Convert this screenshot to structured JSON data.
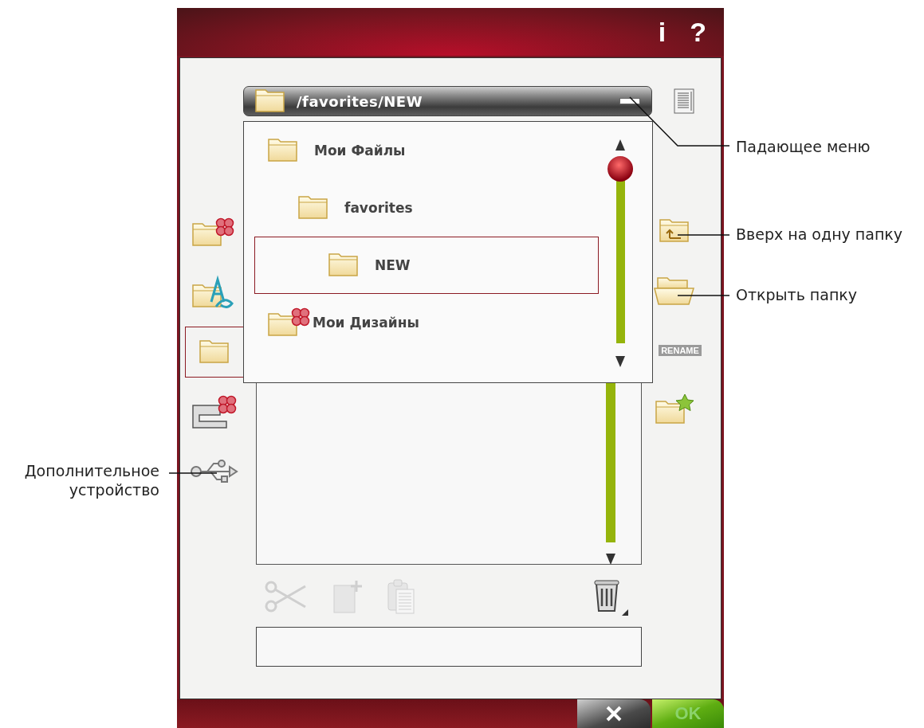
{
  "header": {
    "info": "i",
    "help": "?"
  },
  "path_bar": {
    "path": "/favorites/NEW"
  },
  "dropdown": {
    "items": [
      {
        "label": "Мои Файлы",
        "kind": "folder",
        "selected": false,
        "children": [
          {
            "label": "favorites",
            "kind": "folder",
            "selected": false,
            "children": [
              {
                "label": "NEW",
                "kind": "folder",
                "selected": true
              }
            ]
          }
        ]
      },
      {
        "label": "Мои Дизайны",
        "kind": "designs",
        "selected": false
      }
    ]
  },
  "left_tools": [
    {
      "kind": "designs",
      "selected": false
    },
    {
      "kind": "fonts",
      "selected": false
    },
    {
      "kind": "folder",
      "selected": true
    },
    {
      "kind": "machine",
      "selected": false
    },
    {
      "kind": "usb",
      "selected": false
    }
  ],
  "right_tools": [
    {
      "kind": "up"
    },
    {
      "kind": "open"
    },
    {
      "kind": "rename",
      "label": "RENAME"
    },
    {
      "kind": "favorite"
    }
  ],
  "edit_tools": [
    {
      "kind": "cut",
      "disabled": true
    },
    {
      "kind": "new",
      "disabled": true
    },
    {
      "kind": "paste",
      "disabled": true
    },
    {
      "kind": "delete",
      "disabled": false
    }
  ],
  "footer": {
    "ok": "OK",
    "ok_disabled": true
  },
  "callouts": [
    {
      "text": "Падающее меню"
    },
    {
      "text": "Вверх на одну папку"
    },
    {
      "text": "Открыть папку"
    },
    {
      "text": "Дополнительное устройство"
    }
  ]
}
